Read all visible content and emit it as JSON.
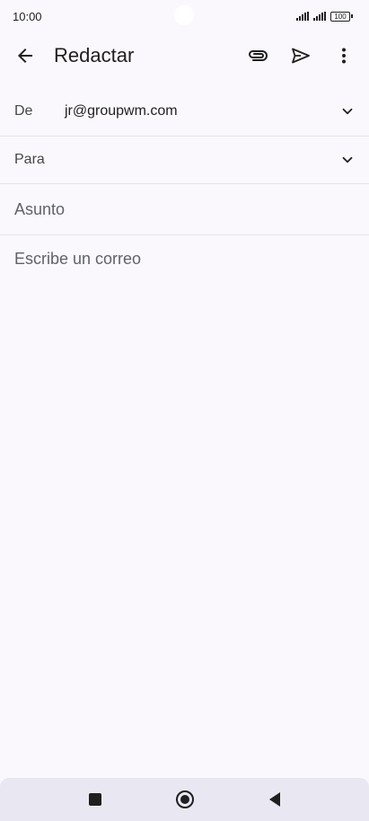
{
  "status_bar": {
    "time": "10:00",
    "battery": "100"
  },
  "app_bar": {
    "title": "Redactar",
    "back_icon": "arrow-left-icon",
    "attach_icon": "paperclip-icon",
    "send_icon": "send-icon",
    "more_icon": "more-vert-icon"
  },
  "compose": {
    "from_label": "De",
    "from_value": "jr@groupwm.com",
    "to_label": "Para",
    "subject_placeholder": "Asunto",
    "body_placeholder": "Escribe un correo"
  },
  "nav_bar": {
    "recents_icon": "square-icon",
    "home_icon": "circle-icon",
    "back_icon": "triangle-back-icon"
  },
  "colors": {
    "background": "#fbf8fd",
    "nav_background": "#e9e8f2",
    "divider": "#e6e3e9",
    "text_primary": "#1f1f1f",
    "text_placeholder": "#5f6368"
  }
}
